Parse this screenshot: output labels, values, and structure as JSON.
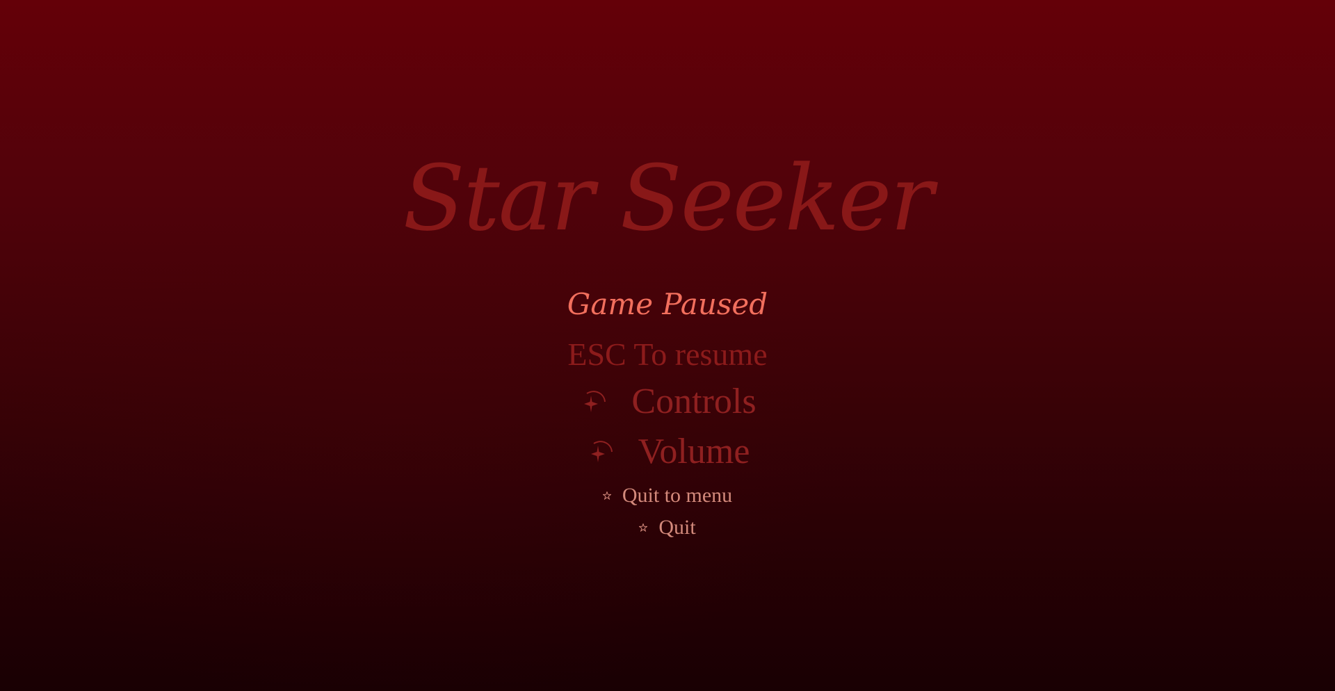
{
  "game": {
    "title": "Star Seeker",
    "subtitle": "Game Paused"
  },
  "menu": {
    "hint": "ESC To resume",
    "items": [
      {
        "label": "Controls",
        "icon": "shooting-star-icon",
        "size": "large"
      },
      {
        "label": "Volume",
        "icon": "shooting-star-icon",
        "size": "large"
      },
      {
        "label": "Quit to menu",
        "icon": "star-icon",
        "size": "small"
      },
      {
        "label": "Quit",
        "icon": "star-icon",
        "size": "small"
      }
    ]
  },
  "colors": {
    "background_top": "#640008",
    "background_bottom": "#190003",
    "title": "#8e1a1a",
    "subtitle": "#f26f5d",
    "menu_large": "#8f2020",
    "menu_small": "#d48a7c"
  }
}
